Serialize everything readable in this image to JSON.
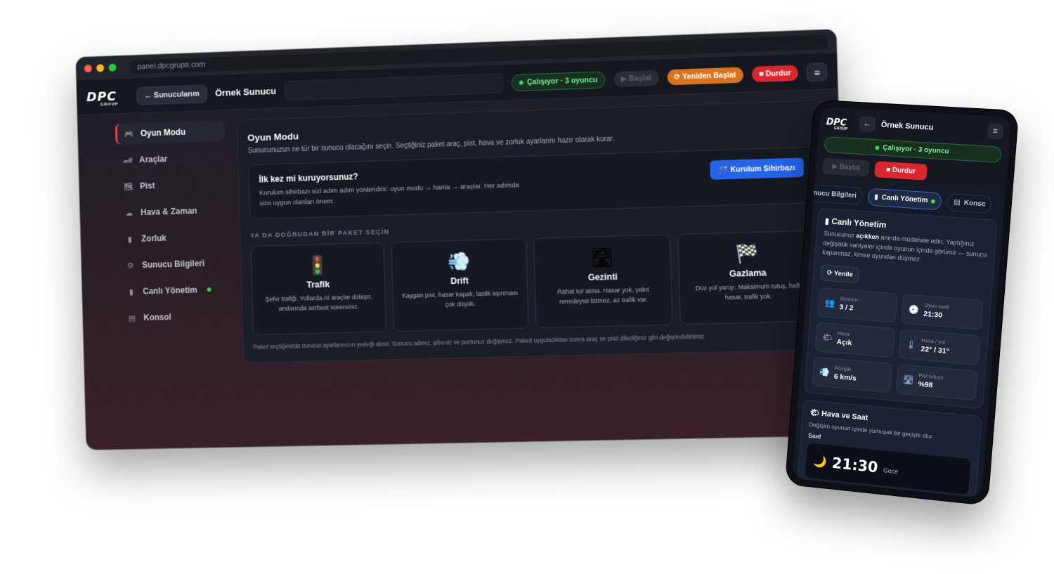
{
  "browser": {
    "url": "panel.dpcgruptr.com"
  },
  "brand": {
    "logo": "DPC",
    "logo_sub": "GROUP"
  },
  "topbar": {
    "back_label": "← Sunucularım",
    "server_name": "Örnek Sunucu",
    "status": "Çalışıyor · 3 oyuncu",
    "start_label": "▶ Başlat",
    "restart_label": "⟳ Yeniden Başlat",
    "stop_label": "■ Durdur",
    "menu_icon": "≡"
  },
  "sidebar": {
    "items": [
      {
        "label": "Oyun Modu",
        "icon": "🎮",
        "active": true
      },
      {
        "label": "Araçlar",
        "icon": "🏎"
      },
      {
        "label": "Pist",
        "icon": "🗺"
      },
      {
        "label": "Hava & Zaman",
        "icon": "☁"
      },
      {
        "label": "Zorluk",
        "icon": "▮"
      },
      {
        "label": "Sunucu Bilgileri",
        "icon": "⚙"
      },
      {
        "label": "Canlı Yönetim",
        "icon": "▮",
        "live": true
      },
      {
        "label": "Konsol",
        "icon": "▤"
      }
    ]
  },
  "main": {
    "title": "Oyun Modu",
    "subtitle": "Sunucunuzun ne tür bir sunucu olacağını seçin. Seçtiğiniz paket araç, pist, hava ve zorluk ayarlarını hazır olarak kurar.",
    "wizard": {
      "title": "İlk kez mi kuruyorsunuz?",
      "text": "Kurulum sihirbazı sizi adım adım yönlendirir: oyun modu → harita → araçlar. Her adımda size uygun olanları önerir.",
      "button": "🪄 Kurulum Sihirbazı"
    },
    "section_label": "YA DA DOĞRUDAN BİR PAKET SEÇİN",
    "packages": [
      {
        "icon": "🚦",
        "name": "Trafik",
        "desc": "Şehir trafiği. Yollarda AI araçlar dolaşır, aralarında serbest sürersiniz."
      },
      {
        "icon": "💨",
        "name": "Drift",
        "desc": "Kaygan pist, hasar kapalı, lastik aşınması çok düşük."
      },
      {
        "icon": "🛣",
        "name": "Gezinti",
        "desc": "Rahat tur atma. Hasar yok, yakıt neredeyse bitmez, az trafik var."
      },
      {
        "icon": "🏁",
        "name": "Gazlama",
        "desc": "Düz yol yarışı. Maksimum tutuş, hafif hasar, trafik yok."
      }
    ],
    "note": "Paket seçtiğinizde mevcut ayarlarınızın yedeği alınır. Sunucu adınız, şifreniz ve portunuz değişmez. Paketi uyguladıktan sonra araç ve pisti dilediğiniz gibi değiştirebilirsiniz."
  },
  "mobile": {
    "back_icon": "←",
    "server_name": "Örnek Sunucu",
    "menu_icon": "≡",
    "status": "Çalışıyor · 3 oyuncu",
    "start_label": "▶ Başlat",
    "stop_label": "■ Durdur",
    "tabs": [
      {
        "label": "nucu Bilgileri"
      },
      {
        "label": "Canlı Yönetim",
        "active": true
      },
      {
        "label": "Konsc"
      }
    ],
    "live": {
      "title": "Canlı Yönetim",
      "text_before": "Sunucunuz ",
      "text_bold": "açıkken",
      "text_after": " anında müdahale edin. Yaptığınız değişiklik saniyeler içinde oyunun içinde görünür — sunucu kapanmaz, kimse oyundan düşmez.",
      "refresh_label": "⟳ Yenile",
      "stats": [
        {
          "icon": "👥",
          "label": "Oyuncu",
          "value": "3 / 2"
        },
        {
          "icon": "🕘",
          "label": "Oyun saati",
          "value": "21:30"
        },
        {
          "icon": "🌤",
          "label": "Hava",
          "value": "Açık"
        },
        {
          "icon": "🌡",
          "label": "Hava / yol",
          "value": "22° / 31°"
        },
        {
          "icon": "💨",
          "label": "Rüzgâr",
          "value": "6 km/s"
        },
        {
          "icon": "🛣",
          "label": "Pist tutuşu",
          "value": "%98"
        }
      ]
    },
    "weather": {
      "title": "🌤 Hava ve Saat",
      "text": "Değişim oyunun içinde yumuşak bir geçişle olur.",
      "time_label": "Saat",
      "time": "21:30",
      "phase": "Gece",
      "moon_icon": "🌙"
    }
  }
}
